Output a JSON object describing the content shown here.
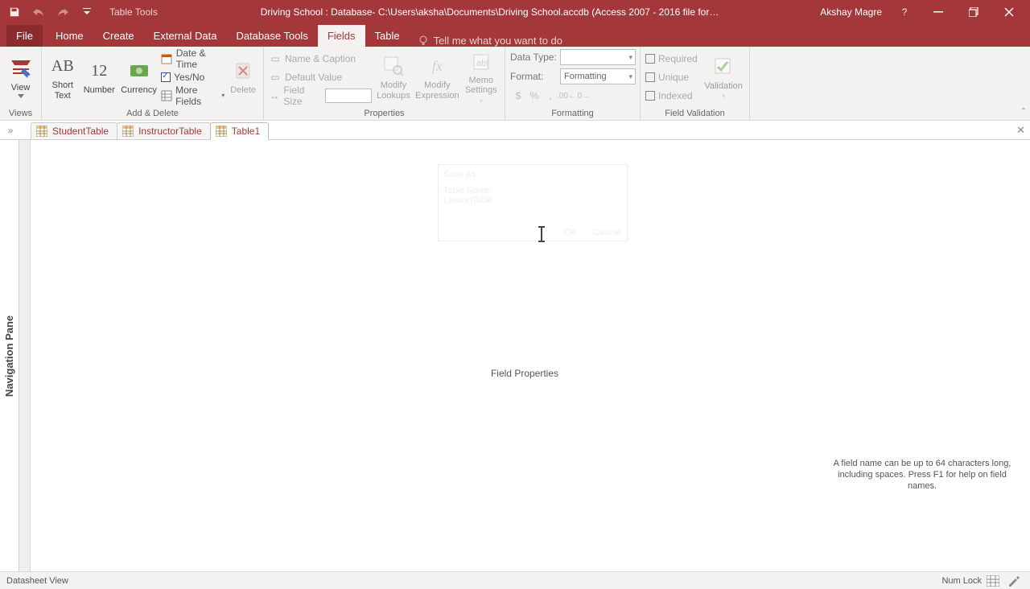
{
  "title_tools": "Table Tools",
  "title_center": "Driving School : Database- C:\\Users\\aksha\\Documents\\Driving School.accdb (Access 2007 - 2016 file for…",
  "user": "Akshay Magre",
  "tabs": {
    "file": "File",
    "home": "Home",
    "create": "Create",
    "external_data": "External Data",
    "database_tools": "Database Tools",
    "fields": "Fields",
    "table": "Table"
  },
  "tell_me_placeholder": "Tell me what you want to do",
  "ribbon": {
    "views": {
      "view": "View",
      "group": "Views"
    },
    "add_delete": {
      "short_text": "Short\nText",
      "number": "Number",
      "currency": "Currency",
      "date_time": "Date & Time",
      "yes_no": "Yes/No",
      "more_fields": "More Fields",
      "delete": "Delete",
      "group": "Add & Delete"
    },
    "properties": {
      "name_caption": "Name & Caption",
      "default_value": "Default Value",
      "field_size": "Field Size",
      "modify_lookups": "Modify\nLookups",
      "modify_expression": "Modify\nExpression",
      "memo_settings": "Memo\nSettings",
      "group": "Properties"
    },
    "formatting": {
      "data_type_label": "Data Type:",
      "format_label": "Format:",
      "format_value": "Formatting",
      "group": "Formatting"
    },
    "validation": {
      "required": "Required",
      "unique": "Unique",
      "indexed": "Indexed",
      "validation": "Validation",
      "group": "Field Validation"
    }
  },
  "object_tabs": [
    "StudentTable",
    "InstructorTable",
    "Table1"
  ],
  "navpane_label": "Navigation Pane",
  "ghost": {
    "title": "Save As",
    "label": "Table Name:",
    "value": "LessonTable",
    "ok": "OK",
    "cancel": "Cancel"
  },
  "field_properties": "Field Properties",
  "help_text": "A field name can be up to 64 characters long, including spaces. Press F1 for help on field names.",
  "status": {
    "left": "Datasheet View",
    "numlock": "Num Lock"
  }
}
